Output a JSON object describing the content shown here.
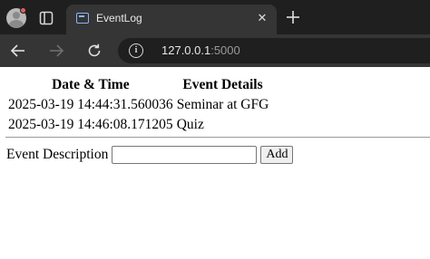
{
  "browser": {
    "tab": {
      "title": "EventLog",
      "close_symbol": "✕",
      "favicon": "terminal-icon"
    },
    "new_tab_symbol": "+",
    "address": {
      "host": "127.0.0.1",
      "port": ":5000"
    },
    "colors": {
      "chrome_dark": "#1f1f1f",
      "chrome_tab": "#353535",
      "accent": "#8ab4f8"
    }
  },
  "page": {
    "table": {
      "headers": [
        "Date & Time",
        "Event Details"
      ],
      "rows": [
        {
          "datetime": "2025-03-19 14:44:31.560036",
          "details": "Seminar at GFG"
        },
        {
          "datetime": "2025-03-19 14:46:08.171205",
          "details": "Quiz"
        }
      ]
    },
    "form": {
      "label": "Event Description",
      "input_value": "",
      "button_label": "Add"
    }
  }
}
